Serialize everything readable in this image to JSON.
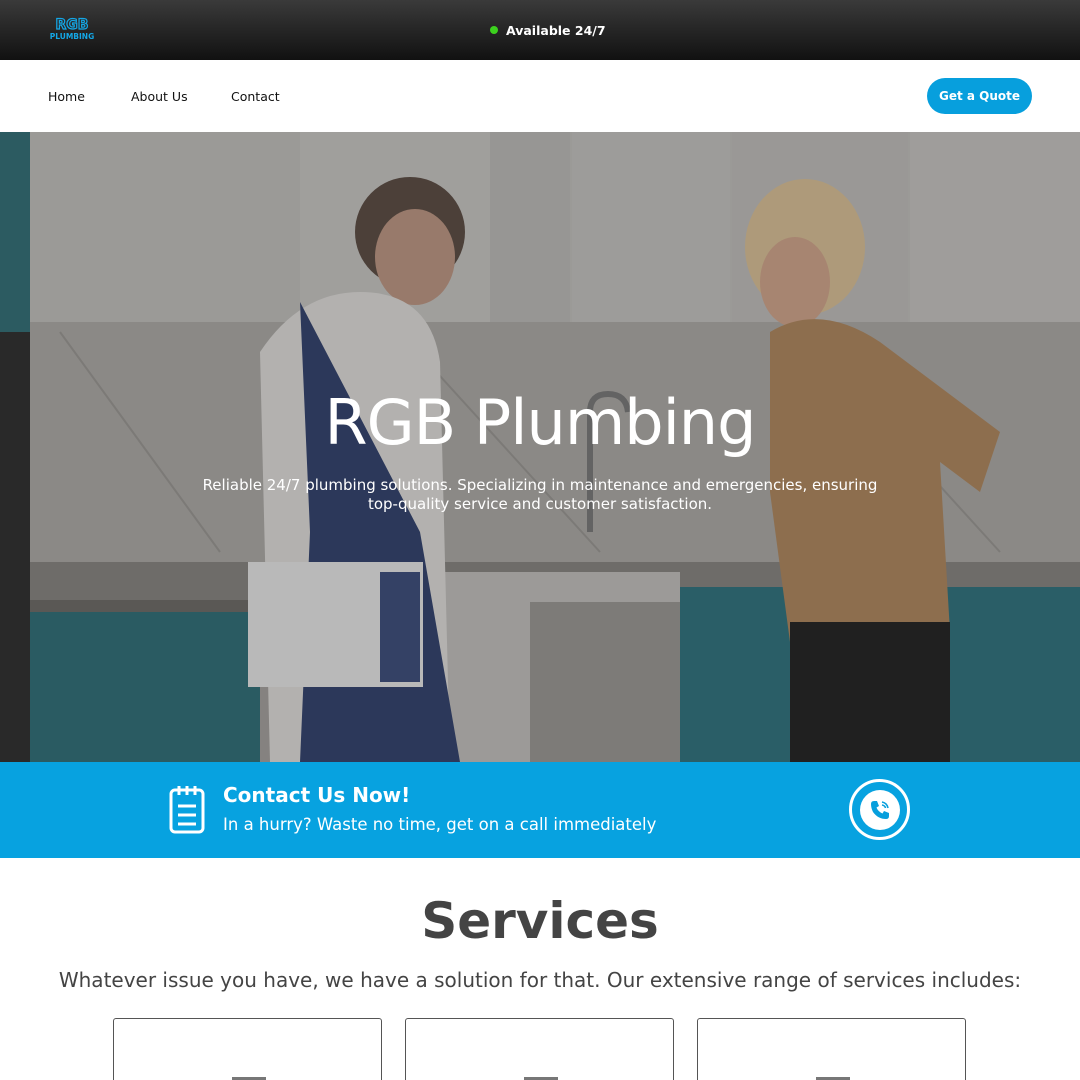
{
  "topbar": {
    "logo_text": "RGB",
    "logo_subtext": "PLUMBING",
    "availability": "Available 24/7",
    "status_color": "#3cd11e"
  },
  "nav": {
    "items": [
      {
        "label": "Home"
      },
      {
        "label": "About Us"
      },
      {
        "label": "Contact"
      }
    ],
    "cta_label": "Get a Quote",
    "accent": "#079fdd"
  },
  "hero": {
    "title": "RGB Plumbing",
    "subtitle": "Reliable 24/7 plumbing solutions. Specializing in maintenance and emergencies, ensuring top-quality service and customer satisfaction."
  },
  "contact_banner": {
    "title": "Contact Us Now!",
    "subtitle": "In a hurry? Waste no time, get on a call immediately",
    "icon": "clipboard-icon",
    "call_icon": "phone-icon",
    "background": "#07a2e0"
  },
  "services": {
    "title": "Services",
    "subtitle": "Whatever issue you have, we have a solution for that. Our extensive range of services includes:",
    "card_count": 3
  }
}
